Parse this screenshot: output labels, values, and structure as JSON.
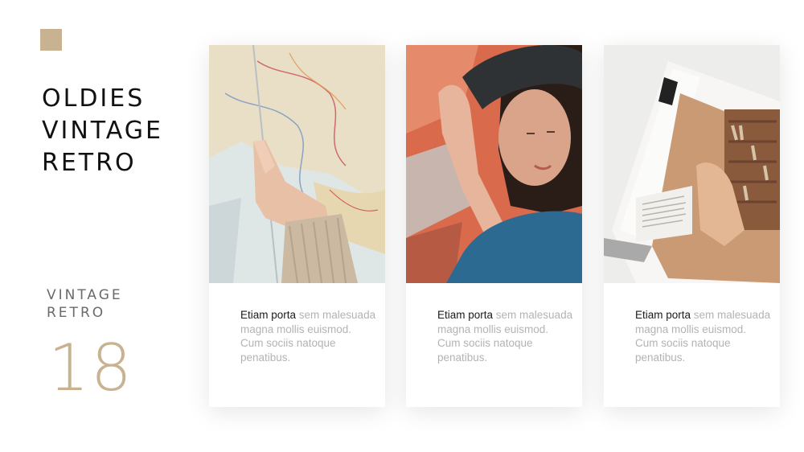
{
  "title_lines": [
    "OLDIES",
    "VINTAGE",
    "RETRO"
  ],
  "subtitle_lines": [
    "VINTAGE",
    "RETRO"
  ],
  "page_number": "18",
  "accent_color": "#c8b291",
  "cards": [
    {
      "photo": "map-photo",
      "lead": "Etiam porta",
      "body": " sem malesuada magna mollis euismod. Cum sociis natoque penatibus."
    },
    {
      "photo": "woman-in-hat-photo",
      "lead": "Etiam porta",
      "body": " sem malesuada magna mollis euismod. Cum sociis natoque penatibus."
    },
    {
      "photo": "magazine-photo",
      "lead": "Etiam porta",
      "body": " sem malesuada magna mollis euismod. Cum sociis natoque penatibus."
    }
  ]
}
